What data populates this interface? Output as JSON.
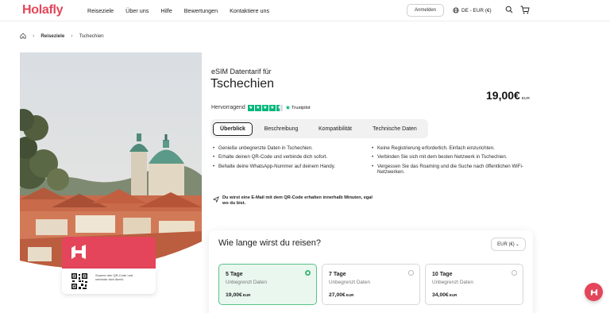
{
  "brand": {
    "logo_text": "Holafly",
    "accent": "#e4455a"
  },
  "header": {
    "nav": [
      "Reiseziele",
      "Über uns",
      "Hilfe",
      "Bewertungen",
      "Kontaktiere uns"
    ],
    "login": "Anmelden",
    "locale": "DE - EUR (€)",
    "icons": [
      "globe-icon",
      "search-icon",
      "cart-icon"
    ]
  },
  "breadcrumb": {
    "items": [
      "Reiseziele",
      "Tschechien"
    ],
    "home_icon": "home-icon"
  },
  "product": {
    "subtitle": "eSIM Datentarif für",
    "title": "Tschechien",
    "price": "19,00€",
    "price_currency": "EUR",
    "rating_label": "Hervorragend",
    "trustpilot": "Trustpilot",
    "stars": 4.5
  },
  "tabs": [
    "Überblick",
    "Beschreibung",
    "Kompatibilität",
    "Technische Daten"
  ],
  "features_left": [
    "Genieße unbegrenzte Daten in Tschechien.",
    "Erhalte deinen QR-Code und verbinde dich sofort.",
    "Behalte deine WhatsApp-Nummer auf deinem Handy."
  ],
  "features_right": [
    "Keine Registrierung erforderlich. Einfach einzurichten.",
    "Verbinden Sie sich mit dem besten Netzwerk in Tschechien.",
    "Vergessen Sie das Roaming und die Suche nach öffentlichen WiFi-Netzwerken."
  ],
  "email_note": "Du wirst eine E-Mail mit dem QR-Code erhalten innerhalb Minuten, egal wo du bist.",
  "card": {
    "scan_text": "Scanne den QR-Code und verbinde dich direkt."
  },
  "travel": {
    "question": "Wie lange wirst du reisen?",
    "currency": "EUR (€)",
    "plans": [
      {
        "days": "5 Tage",
        "data": "Unbegrenzt Daten",
        "price": "19,00€",
        "cur": "EUR",
        "selected": true
      },
      {
        "days": "7 Tage",
        "data": "Unbegrenzt Daten",
        "price": "27,00€",
        "cur": "EUR",
        "selected": false
      },
      {
        "days": "10 Tage",
        "data": "Unbegrenzt Daten",
        "price": "34,00€",
        "cur": "EUR",
        "selected": false
      }
    ]
  },
  "colors": {
    "selected_plan_bg": "#e9f7ef",
    "selected_radio": "#3eb873",
    "trustpilot_green": "#00b67a"
  }
}
